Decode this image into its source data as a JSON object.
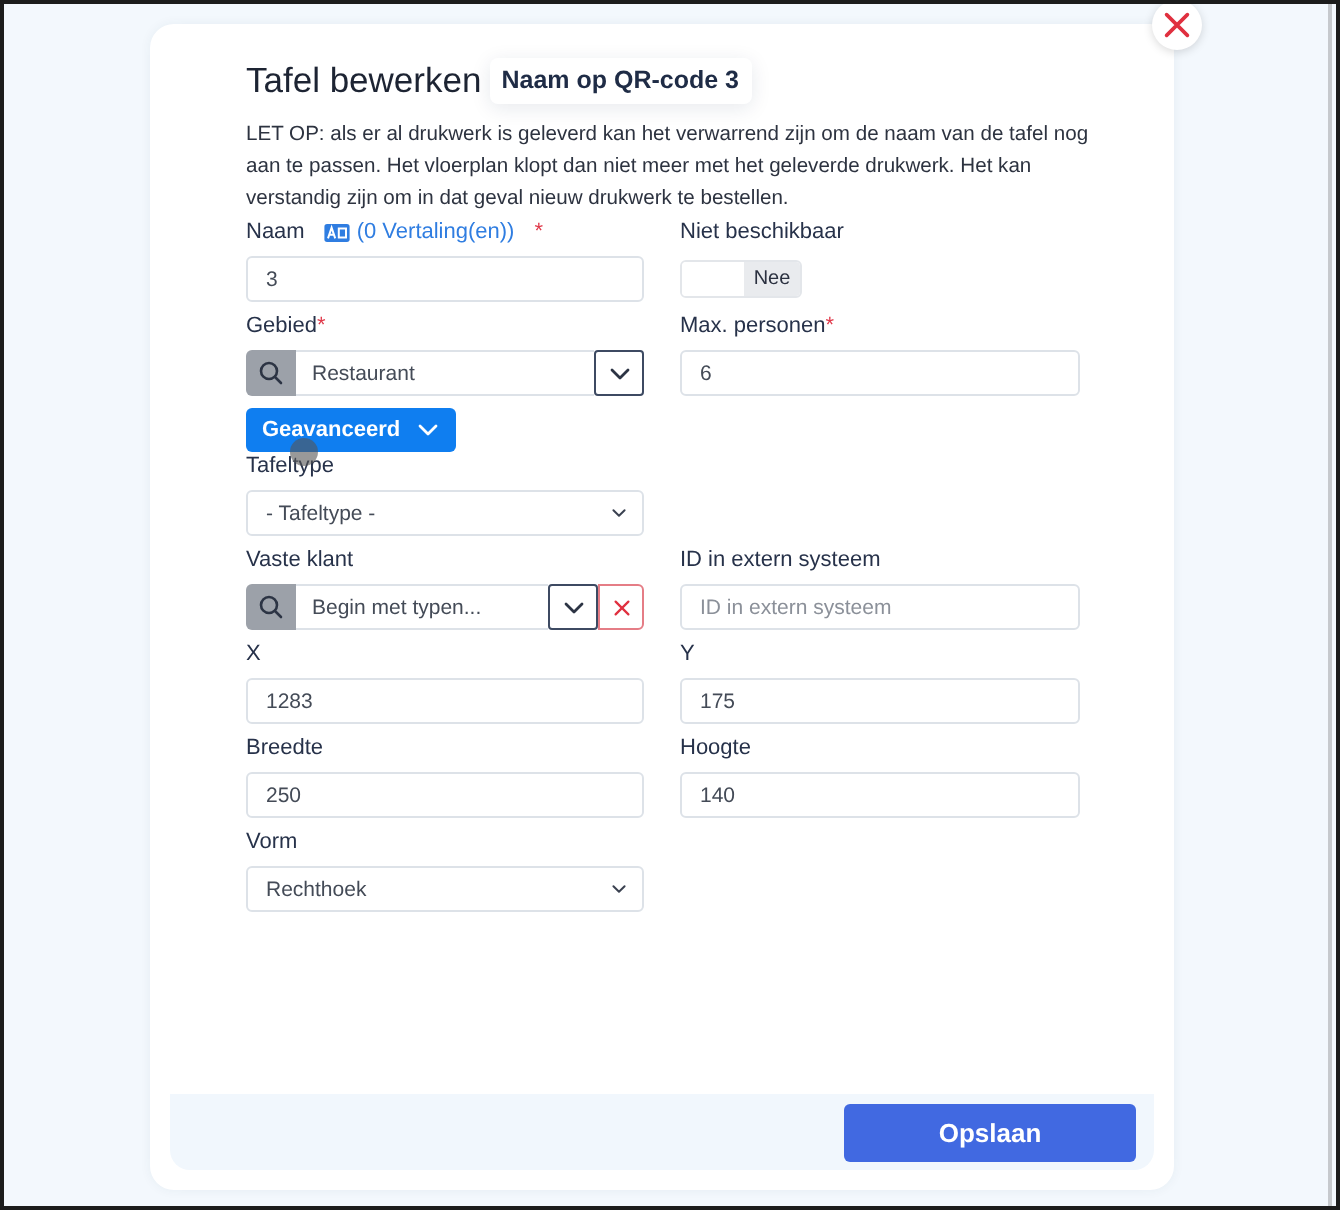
{
  "dialog": {
    "title": "Tafel bewerken",
    "badge": "Naam op QR-code 3",
    "notice": "LET OP: als er al drukwerk is geleverd kan het verwarrend zijn om de naam van de tafel nog aan te passen. Het vloerplan klopt dan niet meer met het geleverde drukwerk. Het kan verstandig zijn om in dat geval nieuw drukwerk te bestellen."
  },
  "rows": [
    [
      {
        "kind": "text",
        "label": "Naam",
        "translations": "(0 Vertaling(en))",
        "required_mark": "*",
        "value": "3"
      },
      {
        "kind": "toggle",
        "label": "Niet beschikbaar",
        "on": false,
        "state_text": "Nee"
      }
    ],
    [
      {
        "kind": "lookup",
        "label": "Gebied",
        "required_mark": "*",
        "value": "Restaurant"
      },
      {
        "kind": "text",
        "label": "Max. personen",
        "required_mark": "*",
        "value": "6"
      }
    ],
    [
      {
        "kind": "button",
        "label": "Geavanceerd"
      }
    ],
    [
      {
        "kind": "select",
        "label": "Tafeltype",
        "value": "- Tafeltype -"
      }
    ],
    [
      {
        "kind": "lookup",
        "label": "Vaste klant",
        "placeholder": "Begin met typen...",
        "clearable": true
      },
      {
        "kind": "text",
        "label": "ID in extern systeem",
        "placeholder": "ID in extern systeem"
      }
    ],
    [
      {
        "kind": "text",
        "label": "X",
        "value": "1283"
      },
      {
        "kind": "text",
        "label": "Y",
        "value": "175"
      }
    ],
    [
      {
        "kind": "text",
        "label": "Breedte",
        "value": "250"
      },
      {
        "kind": "text",
        "label": "Hoogte",
        "value": "140"
      }
    ],
    [
      {
        "kind": "select",
        "label": "Vorm",
        "value": "Rechthoek"
      }
    ]
  ],
  "footer": {
    "save_button": "Opslaan"
  }
}
